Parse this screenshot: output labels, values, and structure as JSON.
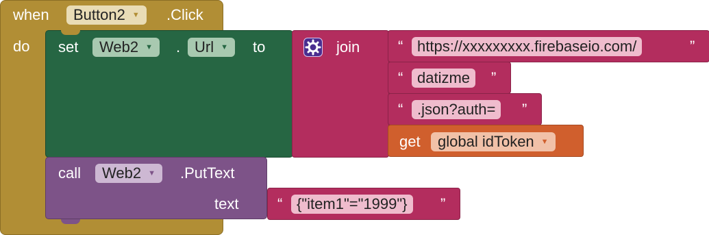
{
  "event": {
    "when_label": "when",
    "component": "Button2",
    "event_name": ".Click",
    "do_label": "do"
  },
  "set_block": {
    "set_label": "set",
    "component": "Web2",
    "dot": ".",
    "property": "Url",
    "to_label": "to"
  },
  "join_block": {
    "label": "join",
    "icon": "gear-icon",
    "items": [
      {
        "open_quote": "“",
        "text": "https://xxxxxxxxx.firebaseio.com/",
        "close_quote": "”"
      },
      {
        "open_quote": "“",
        "text": "datizme",
        "close_quote": "”"
      },
      {
        "open_quote": "“",
        "text": ".json?auth=",
        "close_quote": "”"
      }
    ]
  },
  "get_block": {
    "label": "get",
    "variable": "global idToken"
  },
  "call_block": {
    "call_label": "call",
    "component": "Web2",
    "method": ".PutText",
    "text_label": "text",
    "text_value": {
      "open_quote": "“",
      "text": "{\"item1\"=\"1999\"}",
      "close_quote": "”"
    }
  },
  "dropdown_arrow": "▼",
  "colors": {
    "event": "#b18e35",
    "set": "#266643",
    "call": "#7d5388",
    "text": "#b32d5e",
    "get": "#d05f2d"
  }
}
